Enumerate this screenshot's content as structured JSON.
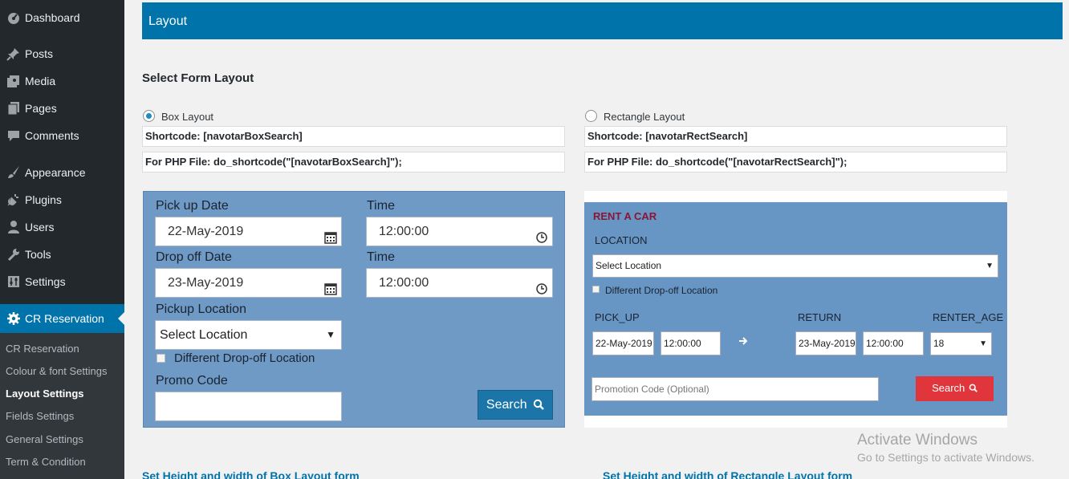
{
  "sidebar": {
    "items": [
      {
        "label": "Dashboard",
        "icon": "dashboard-icon"
      },
      {
        "label": "Posts",
        "icon": "pin-icon"
      },
      {
        "label": "Media",
        "icon": "media-icon"
      },
      {
        "label": "Pages",
        "icon": "pages-icon"
      },
      {
        "label": "Comments",
        "icon": "comment-icon"
      },
      {
        "label": "Appearance",
        "icon": "brush-icon"
      },
      {
        "label": "Plugins",
        "icon": "plug-icon"
      },
      {
        "label": "Users",
        "icon": "user-icon"
      },
      {
        "label": "Tools",
        "icon": "wrench-icon"
      },
      {
        "label": "Settings",
        "icon": "settings-icon"
      },
      {
        "label": "CR Reservation",
        "icon": "gear-icon",
        "active": true
      }
    ],
    "submenu": [
      {
        "label": "CR Reservation"
      },
      {
        "label": "Colour & font Settings"
      },
      {
        "label": "Layout Settings",
        "current": true
      },
      {
        "label": "Fields Settings"
      },
      {
        "label": "General Settings"
      },
      {
        "label": "Term & Condition"
      }
    ]
  },
  "header": {
    "title": "Layout"
  },
  "section": {
    "title": "Select Form Layout"
  },
  "box_layout": {
    "radio_label": "Box Layout",
    "selected": true,
    "shortcode": "Shortcode: [navotarBoxSearch]",
    "php": "For PHP File: do_shortcode(\"[navotarBoxSearch]\");",
    "form": {
      "pickup_date_label": "Pick up Date",
      "pickup_date_value": "22-May-2019",
      "time_label": "Time",
      "pickup_time_value": "12:00:00",
      "dropoff_date_label": "Drop off Date",
      "dropoff_date_value": "23-May-2019",
      "dropoff_time_value": "12:00:00",
      "pickup_location_label": "Pickup Location",
      "location_select": "Select Location",
      "different_dropoff": "Different Drop-off Location",
      "promo_label": "Promo Code",
      "promo_value": "",
      "search_button": "Search"
    }
  },
  "rect_layout": {
    "radio_label": "Rectangle Layout",
    "selected": false,
    "shortcode": "Shortcode: [navotarRectSearch]",
    "php": "For PHP File: do_shortcode(\"[navotarRectSearch]\");",
    "form": {
      "title": "RENT A CAR",
      "location_label": "LOCATION",
      "location_select": "Select Location",
      "different_dropoff": "Different Drop-off Location",
      "pickup_label": "PICK_UP",
      "return_label": "RETURN",
      "renter_age_label": "RENTER_AGE",
      "pickup_date": "22-May-2019",
      "pickup_time": "12:00:00",
      "return_date": "23-May-2019",
      "return_time": "12:00:00",
      "renter_age": "18",
      "promo_placeholder": "Promotion Code (Optional)",
      "search_button": "Search"
    }
  },
  "bottom_links": {
    "box": "Set Height and width of Box Layout form",
    "rect": "Set Height and width of Rectangle Layout form"
  },
  "watermark": {
    "line1": "Activate Windows",
    "line2": "Go to Settings to activate Windows."
  },
  "colors": {
    "sidebar_bg": "#23282d",
    "accent": "#0073aa",
    "box_form_bg": "#6e9ac5",
    "rect_form_bg": "#6796c5",
    "rect_search_bg": "#e0353a"
  }
}
